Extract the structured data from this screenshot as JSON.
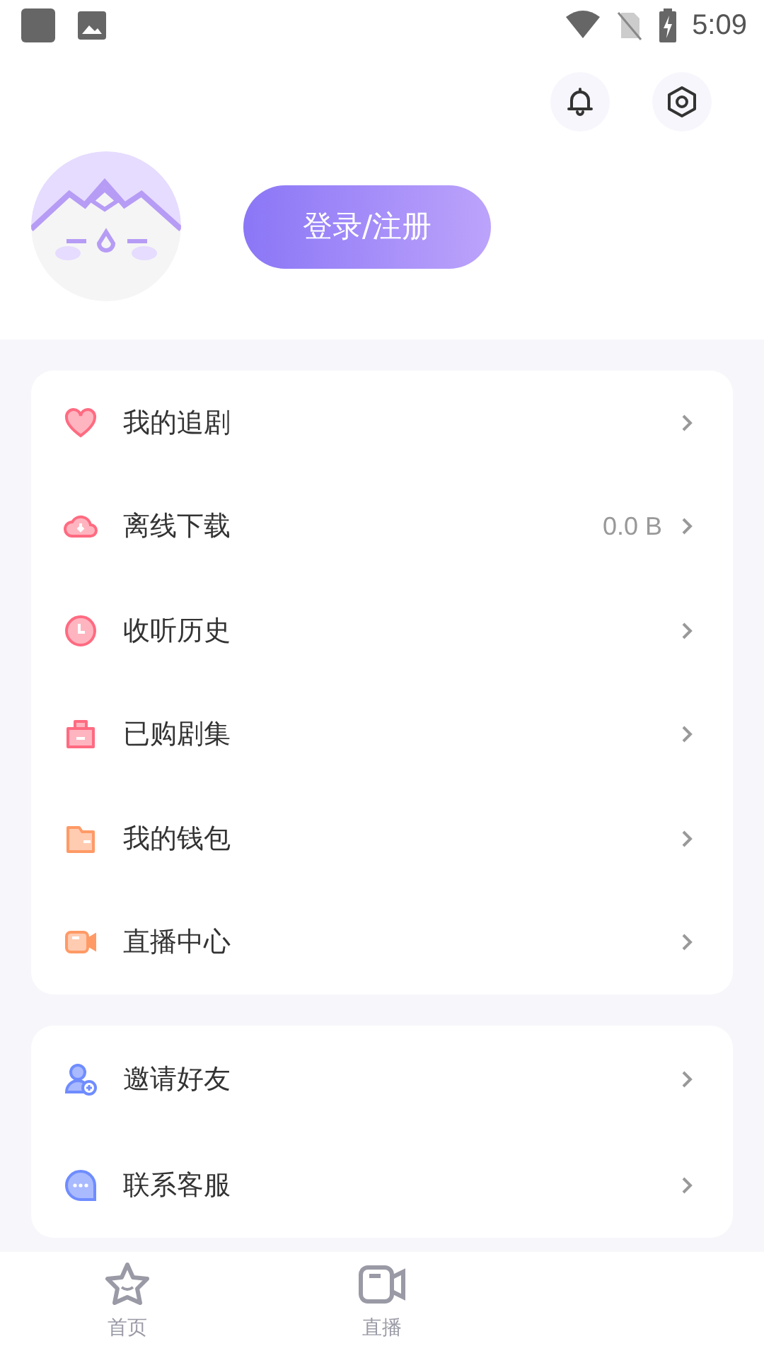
{
  "status_bar": {
    "time": "5:09"
  },
  "header": {
    "login_button": "登录/注册"
  },
  "menu_groups": [
    {
      "items": [
        {
          "label": "我的追剧",
          "kind": "heart",
          "color": "#ff6b81"
        },
        {
          "label": "离线下载",
          "kind": "cloud",
          "color": "#ff6b81",
          "value": "0.0 B"
        },
        {
          "label": "收听历史",
          "kind": "clock",
          "color": "#ff6b81"
        },
        {
          "label": "已购剧集",
          "kind": "bag",
          "color": "#ff6b81"
        },
        {
          "label": "我的钱包",
          "kind": "wallet",
          "color": "#ff9a66"
        },
        {
          "label": "直播中心",
          "kind": "camera",
          "color": "#ff9a66"
        }
      ]
    },
    {
      "items": [
        {
          "label": "邀请好友",
          "kind": "useradd",
          "color": "#6f8cff"
        },
        {
          "label": "联系客服",
          "kind": "chat",
          "color": "#6f8cff"
        }
      ]
    }
  ],
  "tab_bar": [
    {
      "label": "首页",
      "kind": "star",
      "selected": false
    },
    {
      "label": "直播",
      "kind": "camera",
      "selected": false
    }
  ]
}
